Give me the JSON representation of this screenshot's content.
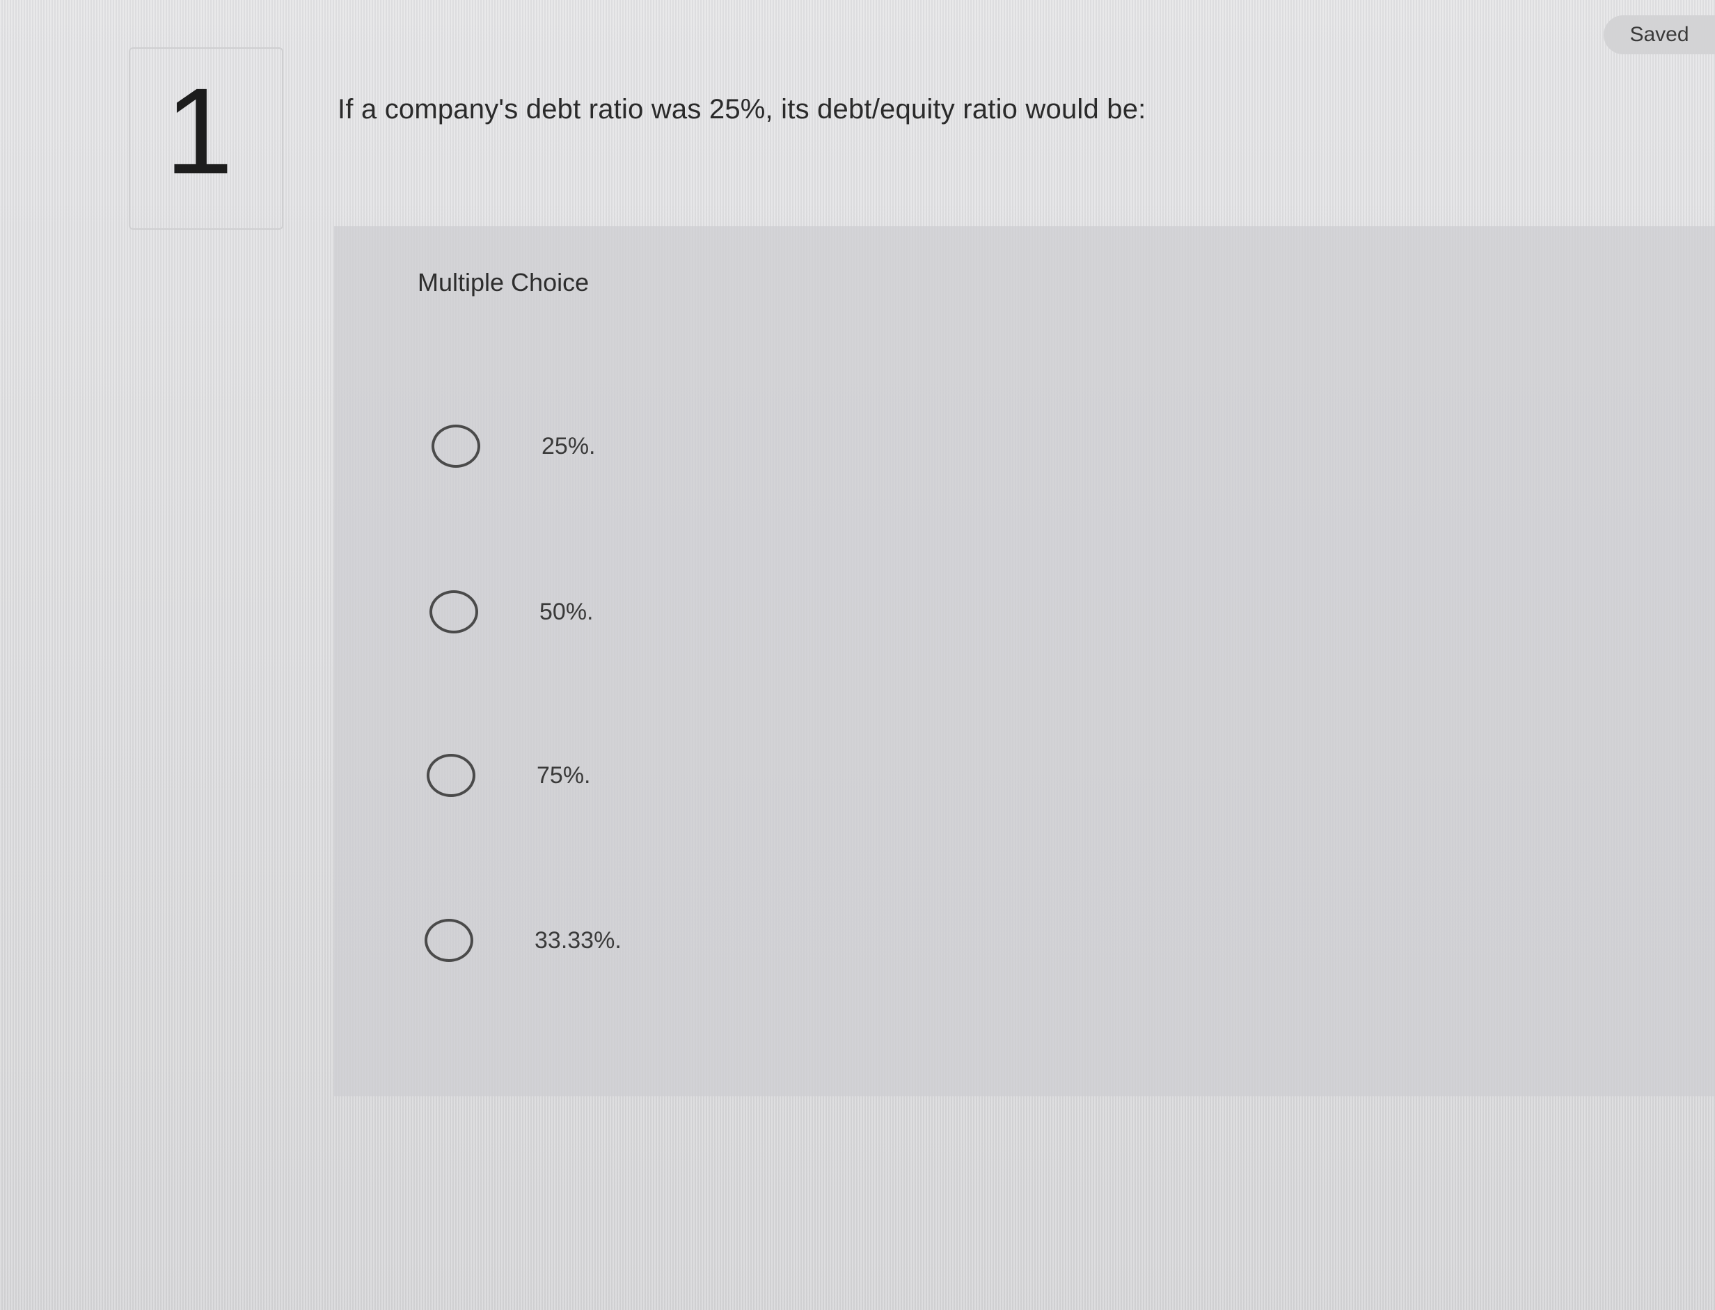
{
  "status": {
    "saved_label": "Saved"
  },
  "question": {
    "number": "1",
    "text": "If a company's debt ratio was 25%, its debt/equity ratio would be:"
  },
  "answer_area": {
    "heading": "Multiple Choice",
    "options": [
      {
        "label": "25%.",
        "selected": false,
        "icon": "radio-empty-icon"
      },
      {
        "label": "50%.",
        "selected": false,
        "icon": "radio-empty-icon"
      },
      {
        "label": "75%.",
        "selected": false,
        "icon": "radio-empty-icon"
      },
      {
        "label": "33.33%.",
        "selected": false,
        "icon": "radio-empty-icon"
      }
    ]
  },
  "colors": {
    "background": "#dcdcde",
    "panel": "#cecece",
    "text": "#2b2b2b",
    "radio_border": "#4a4a4a"
  }
}
